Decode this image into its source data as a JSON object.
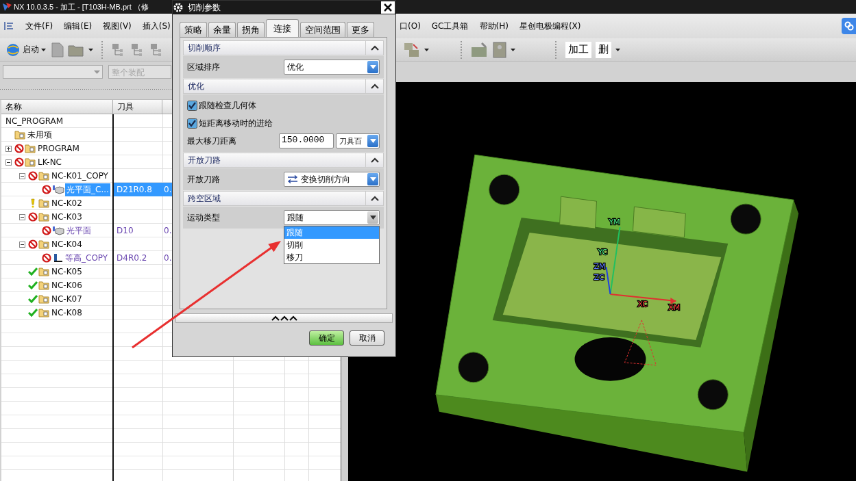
{
  "window": {
    "title": "NX 10.0.3.5 - 加工 - [T103H-MB.prt （修"
  },
  "menu_bar": {
    "items_left": [
      "文件(F)",
      "编辑(E)",
      "视图(V)",
      "插入(S)"
    ],
    "items_right": [
      "口(O)",
      "GC工具箱",
      "帮助(H)",
      "星创电极编程(X)"
    ]
  },
  "toolbar": {
    "start_button": "启动",
    "text_buttons": [
      "加工",
      "删"
    ]
  },
  "filter_bar": {
    "scope": {
      "value": "整个装配",
      "disabled": true
    }
  },
  "navigator": {
    "columns": [
      "名称",
      "刀具"
    ],
    "tree": [
      {
        "name": "NC_PROGRAM",
        "kind": "root",
        "selected": false,
        "children": [
          {
            "name": "未用项",
            "kind": "group",
            "selected": false
          },
          {
            "name": "PROGRAM",
            "kind": "group",
            "status": {
              "kind": "prohibited"
            },
            "selected": false,
            "expanded": false
          },
          {
            "name": "LK-NC",
            "kind": "group",
            "status": {
              "kind": "prohibited"
            },
            "selected": false,
            "expanded": true,
            "children": [
              {
                "name": "NC-K01_COPY",
                "kind": "group",
                "status": {
                  "kind": "prohibited"
                },
                "selected": false,
                "expanded": true,
                "children": [
                  {
                    "name": "光平面_C...",
                    "kind": "face_operation",
                    "status": {
                      "kind": "prohibited"
                    },
                    "tool": "D21R0.8",
                    "column_3": "0.",
                    "selected": true
                  }
                ]
              },
              {
                "name": "NC-K02",
                "kind": "group",
                "status": {
                  "kind": "warning"
                },
                "selected": false
              },
              {
                "name": "NC-K03",
                "kind": "group",
                "status": {
                  "kind": "prohibited"
                },
                "selected": false,
                "expanded": true,
                "children": [
                  {
                    "name": "光平面",
                    "kind": "face_operation",
                    "status": {
                      "kind": "prohibited"
                    },
                    "tool": "D10",
                    "column_3": "0.",
                    "selected": false
                  }
                ]
              },
              {
                "name": "NC-K04",
                "kind": "group",
                "status": {
                  "kind": "prohibited"
                },
                "selected": false,
                "expanded": true,
                "children": [
                  {
                    "name": "等高_COPY",
                    "kind": "zlevel_operation",
                    "status": {
                      "kind": "prohibited"
                    },
                    "tool": "D4R0.2",
                    "column_3": "0.",
                    "selected": false
                  }
                ]
              },
              {
                "name": "NC-K05",
                "kind": "group",
                "status": {
                  "kind": "complete"
                },
                "selected": false
              },
              {
                "name": "NC-K06",
                "kind": "group",
                "status": {
                  "kind": "complete"
                },
                "selected": false
              },
              {
                "name": "NC-K07",
                "kind": "group",
                "status": {
                  "kind": "complete"
                },
                "selected": false
              },
              {
                "name": "NC-K08",
                "kind": "group",
                "status": {
                  "kind": "complete"
                },
                "selected": false
              }
            ]
          }
        ]
      }
    ]
  },
  "viewport": {
    "axis_labels": [
      {
        "text": "YM",
        "kind": "y_axis"
      },
      {
        "text": "YC",
        "kind": "y_axis"
      },
      {
        "text": "ZM",
        "kind": "z_axis"
      },
      {
        "text": "ZC",
        "kind": "z_axis"
      },
      {
        "text": "XC",
        "kind": "x_axis"
      },
      {
        "text": "XM",
        "kind": "x_axis"
      }
    ]
  },
  "dialog": {
    "title": "切削参数",
    "tabs": [
      {
        "label": "策略",
        "selected": false
      },
      {
        "label": "余量",
        "selected": false
      },
      {
        "label": "拐角",
        "selected": false
      },
      {
        "label": "连接",
        "selected": true
      },
      {
        "label": "空间范围",
        "selected": false
      },
      {
        "label": "更多",
        "selected": false
      }
    ],
    "sections": [
      {
        "title": "切削顺序",
        "expanded": true,
        "fields": [
          {
            "kind": "select",
            "label": "区域排序",
            "value": "优化"
          }
        ]
      },
      {
        "title": "优化",
        "expanded": true,
        "fields": [
          {
            "kind": "checkbox",
            "label": "跟随检查几何体",
            "checked": true
          },
          {
            "kind": "checkbox",
            "label": "短距离移动时的进给",
            "checked": true
          },
          {
            "kind": "number",
            "label": "最大移刀距离",
            "value": "150.0000",
            "unit": "刀具百"
          }
        ]
      },
      {
        "title": "开放刀路",
        "expanded": true,
        "fields": [
          {
            "kind": "icon_select",
            "label": "开放刀路",
            "value": "变换切削方向"
          }
        ]
      },
      {
        "title": "跨空区域",
        "expanded": true,
        "fields": [
          {
            "kind": "select",
            "label": "运动类型",
            "value": "跟随",
            "open": true,
            "options": [
              {
                "label": "跟随",
                "selected": true
              },
              {
                "label": "切削",
                "selected": false
              },
              {
                "label": "移刀",
                "selected": false
              }
            ]
          }
        ]
      }
    ],
    "buttons": [
      {
        "label": "确定",
        "kind": "primary"
      },
      {
        "label": "取消",
        "kind": "secondary"
      }
    ]
  }
}
